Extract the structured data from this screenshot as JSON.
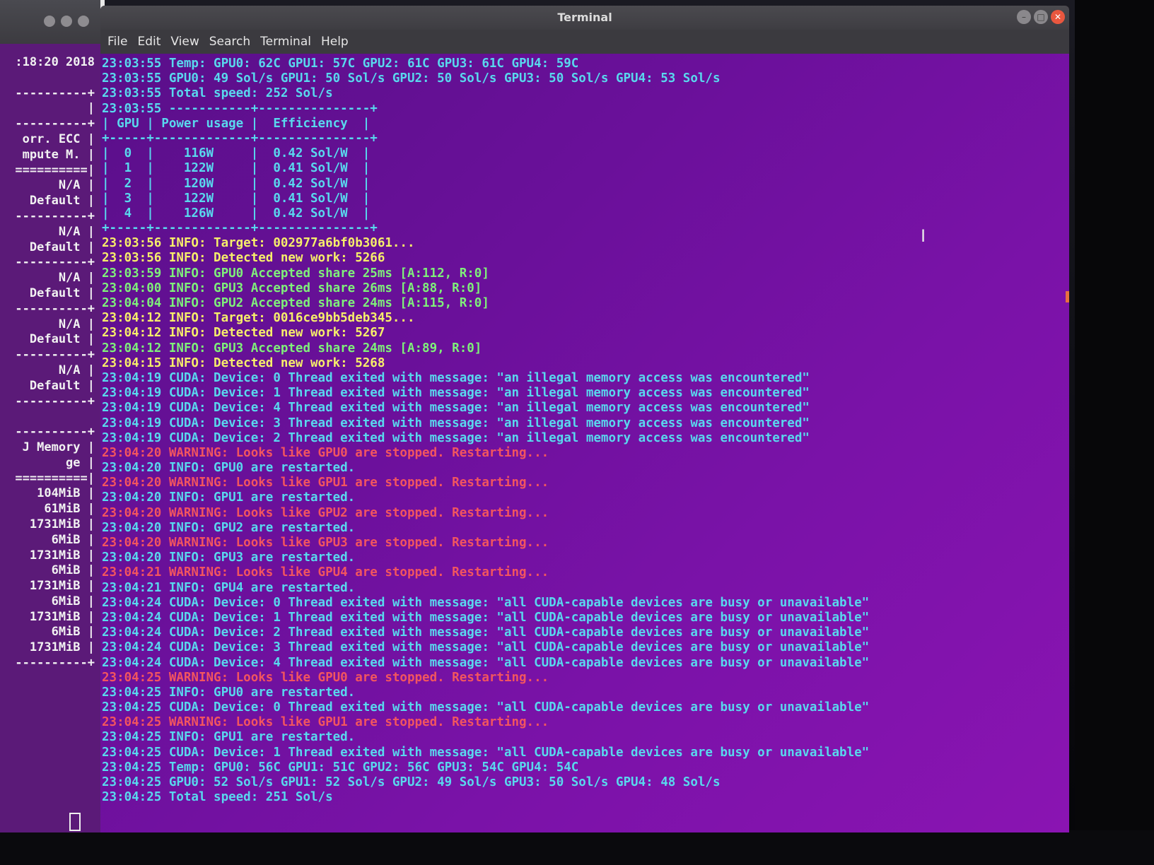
{
  "window_title": "Terminal",
  "menu": [
    "File",
    "Edit",
    "View",
    "Search",
    "Terminal",
    "Help"
  ],
  "background_terminal": {
    "lines": [
      ":18:20 2018",
      "",
      "----------+",
      "|",
      "----------+",
      "orr. ECC |",
      "mpute M. |",
      "==========|",
      "N/A |",
      "Default |",
      "----------+",
      "N/A |",
      "Default |",
      "----------+",
      "N/A |",
      "Default |",
      "----------+",
      "N/A |",
      "Default |",
      "----------+",
      "N/A |",
      "Default |",
      "----------+",
      "",
      "----------+",
      "J Memory |",
      "ge |",
      "==========|",
      "104MiB |",
      "61MiB |",
      "1731MiB |",
      "6MiB |",
      "1731MiB |",
      "6MiB |",
      "1731MiB |",
      "6MiB |",
      "1731MiB |",
      "6MiB |",
      "1731MiB |",
      "----------+"
    ]
  },
  "terminal_lines": [
    {
      "text": "23:03:55 Temp: GPU0: 62C GPU1: 57C GPU2: 61C GPU3: 61C GPU4: 59C",
      "color": "cyan"
    },
    {
      "text": "23:03:55 GPU0: 49 Sol/s GPU1: 50 Sol/s GPU2: 50 Sol/s GPU3: 50 Sol/s GPU4: 53 Sol/s",
      "color": "cyan"
    },
    {
      "text": "23:03:55 Total speed: 252 Sol/s",
      "color": "cyan"
    },
    {
      "text": "23:03:55 -----------+---------------+",
      "color": "cyan"
    },
    {
      "text": "| GPU | Power usage |  Efficiency  |",
      "color": "cyan"
    },
    {
      "text": "+-----+-------------+---------------+",
      "color": "cyan"
    },
    {
      "text": "|  0  |    116W     |  0.42 Sol/W  |",
      "color": "cyan"
    },
    {
      "text": "|  1  |    122W     |  0.41 Sol/W  |",
      "color": "cyan"
    },
    {
      "text": "|  2  |    120W     |  0.42 Sol/W  |",
      "color": "cyan"
    },
    {
      "text": "|  3  |    122W     |  0.41 Sol/W  |",
      "color": "cyan"
    },
    {
      "text": "|  4  |    126W     |  0.42 Sol/W  |",
      "color": "cyan"
    },
    {
      "text": "+-----+-------------+---------------+",
      "color": "cyan"
    },
    {
      "text": "23:03:56 INFO: Target: 002977a6bf0b3061...",
      "color": "yellow"
    },
    {
      "text": "23:03:56 INFO: Detected new work: 5266",
      "color": "yellow"
    },
    {
      "text": "23:03:59 INFO: GPU0 Accepted share 25ms [A:112, R:0]",
      "color": "green"
    },
    {
      "text": "23:04:00 INFO: GPU3 Accepted share 26ms [A:88, R:0]",
      "color": "green"
    },
    {
      "text": "23:04:04 INFO: GPU2 Accepted share 24ms [A:115, R:0]",
      "color": "green"
    },
    {
      "text": "23:04:12 INFO: Target: 0016ce9bb5deb345...",
      "color": "yellow"
    },
    {
      "text": "23:04:12 INFO: Detected new work: 5267",
      "color": "yellow"
    },
    {
      "text": "23:04:12 INFO: GPU3 Accepted share 24ms [A:89, R:0]",
      "color": "green"
    },
    {
      "text": "23:04:15 INFO: Detected new work: 5268",
      "color": "yellow"
    },
    {
      "text": "23:04:19 CUDA: Device: 0 Thread exited with message: \"an illegal memory access was encountered\"",
      "color": "cyan"
    },
    {
      "text": "23:04:19 CUDA: Device: 1 Thread exited with message: \"an illegal memory access was encountered\"",
      "color": "cyan"
    },
    {
      "text": "23:04:19 CUDA: Device: 4 Thread exited with message: \"an illegal memory access was encountered\"",
      "color": "cyan"
    },
    {
      "text": "23:04:19 CUDA: Device: 3 Thread exited with message: \"an illegal memory access was encountered\"",
      "color": "cyan"
    },
    {
      "text": "23:04:19 CUDA: Device: 2 Thread exited with message: \"an illegal memory access was encountered\"",
      "color": "cyan"
    },
    {
      "text": "23:04:20 WARNING: Looks like GPU0 are stopped. Restarting...",
      "color": "red"
    },
    {
      "text": "23:04:20 INFO: GPU0 are restarted.",
      "color": "cyan"
    },
    {
      "text": "23:04:20 WARNING: Looks like GPU1 are stopped. Restarting...",
      "color": "red"
    },
    {
      "text": "23:04:20 INFO: GPU1 are restarted.",
      "color": "cyan"
    },
    {
      "text": "23:04:20 WARNING: Looks like GPU2 are stopped. Restarting...",
      "color": "red"
    },
    {
      "text": "23:04:20 INFO: GPU2 are restarted.",
      "color": "cyan"
    },
    {
      "text": "23:04:20 WARNING: Looks like GPU3 are stopped. Restarting...",
      "color": "red"
    },
    {
      "text": "23:04:20 INFO: GPU3 are restarted.",
      "color": "cyan"
    },
    {
      "text": "23:04:21 WARNING: Looks like GPU4 are stopped. Restarting...",
      "color": "red"
    },
    {
      "text": "23:04:21 INFO: GPU4 are restarted.",
      "color": "cyan"
    },
    {
      "text": "23:04:24 CUDA: Device: 0 Thread exited with message: \"all CUDA-capable devices are busy or unavailable\"",
      "color": "cyan"
    },
    {
      "text": "23:04:24 CUDA: Device: 1 Thread exited with message: \"all CUDA-capable devices are busy or unavailable\"",
      "color": "cyan"
    },
    {
      "text": "23:04:24 CUDA: Device: 2 Thread exited with message: \"all CUDA-capable devices are busy or unavailable\"",
      "color": "cyan"
    },
    {
      "text": "23:04:24 CUDA: Device: 3 Thread exited with message: \"all CUDA-capable devices are busy or unavailable\"",
      "color": "cyan"
    },
    {
      "text": "23:04:24 CUDA: Device: 4 Thread exited with message: \"all CUDA-capable devices are busy or unavailable\"",
      "color": "cyan"
    },
    {
      "text": "23:04:25 WARNING: Looks like GPU0 are stopped. Restarting...",
      "color": "red"
    },
    {
      "text": "23:04:25 INFO: GPU0 are restarted.",
      "color": "cyan"
    },
    {
      "text": "23:04:25 CUDA: Device: 0 Thread exited with message: \"all CUDA-capable devices are busy or unavailable\"",
      "color": "cyan"
    },
    {
      "text": "23:04:25 WARNING: Looks like GPU1 are stopped. Restarting...",
      "color": "red"
    },
    {
      "text": "23:04:25 INFO: GPU1 are restarted.",
      "color": "cyan"
    },
    {
      "text": "23:04:25 CUDA: Device: 1 Thread exited with message: \"all CUDA-capable devices are busy or unavailable\"",
      "color": "cyan"
    },
    {
      "text": "23:04:25 Temp: GPU0: 56C GPU1: 51C GPU2: 56C GPU3: 54C GPU4: 54C",
      "color": "cyan"
    },
    {
      "text": "23:04:25 GPU0: 52 Sol/s GPU1: 52 Sol/s GPU2: 49 Sol/s GPU3: 50 Sol/s GPU4: 48 Sol/s",
      "color": "cyan"
    },
    {
      "text": "23:04:25 Total speed: 251 Sol/s",
      "color": "cyan"
    }
  ],
  "colors": {
    "cyan": "#59d8ee",
    "yellow": "#f6ee6a",
    "green": "#7ff07a",
    "red": "#f2555f",
    "terminal_bg": "#6a109a"
  }
}
